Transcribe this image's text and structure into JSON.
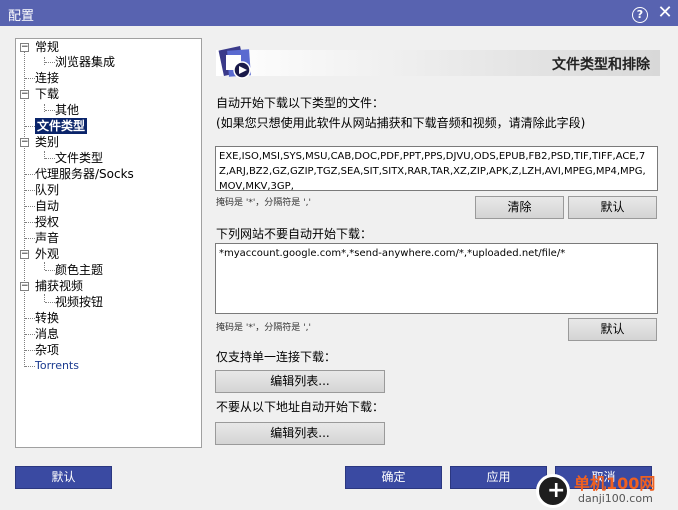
{
  "window": {
    "title": "配置",
    "help_label": "?",
    "close_label": "✕"
  },
  "tree": {
    "items": [
      {
        "label": "常规"
      },
      {
        "label": "浏览器集成"
      },
      {
        "label": "连接"
      },
      {
        "label": "下载"
      },
      {
        "label": "其他"
      },
      {
        "label": "文件类型"
      },
      {
        "label": "类别"
      },
      {
        "label": "文件类型"
      },
      {
        "label": "代理服务器/Socks"
      },
      {
        "label": "队列"
      },
      {
        "label": "自动"
      },
      {
        "label": "授权"
      },
      {
        "label": "声音"
      },
      {
        "label": "外观"
      },
      {
        "label": "颜色主题"
      },
      {
        "label": "捕获视频"
      },
      {
        "label": "视频按钮"
      },
      {
        "label": "转换"
      },
      {
        "label": "消息"
      },
      {
        "label": "杂项"
      },
      {
        "label": "Torrents"
      }
    ],
    "expander_symbol": "−"
  },
  "header": {
    "title": "文件类型和排除"
  },
  "auto_types": {
    "label": "自动开始下载以下类型的文件：",
    "hint": "(如果您只想使用此软件从网站捕获和下载音频和视频，请清除此字段)",
    "value": "EXE,ISO,MSI,SYS,MSU,CAB,DOC,PDF,PPT,PPS,DJVU,ODS,EPUB,FB2,PSD,TIF,TIFF,ACE,7Z,ARJ,BZ2,GZ,GZIP,TGZ,SEA,SIT,SITX,RAR,TAR,XZ,ZIP,APK,Z,LZH,AVI,MPEG,MP4,MPG,MOV,MKV,3GP,",
    "note": "掩码是 '*'，分隔符是 ','",
    "clear_label": "清除",
    "default_label": "默认"
  },
  "excluded_sites": {
    "label": "下列网站不要自动开始下载：",
    "value": "*myaccount.google.com*,*send-anywhere.com/*,*uploaded.net/file/*",
    "note": "掩码是 '*'，分隔符是 ','",
    "default_label": "默认"
  },
  "single_conn": {
    "label": "仅支持单一连接下载：",
    "edit_label": "编辑列表..."
  },
  "no_auto_addr": {
    "label": "不要从以下地址自动开始下载：",
    "edit_label": "编辑列表..."
  },
  "footer": {
    "default_label": "默认",
    "ok_label": "确定",
    "apply_label": "应用",
    "cancel_label": "取消"
  },
  "watermark": {
    "glyph": "+",
    "site_name": "单机100网",
    "site_url": "danji100.com"
  },
  "colors": {
    "titlebar": "#5863b0",
    "button_blue": "#3a4aa2",
    "selected": "#0a246a"
  }
}
